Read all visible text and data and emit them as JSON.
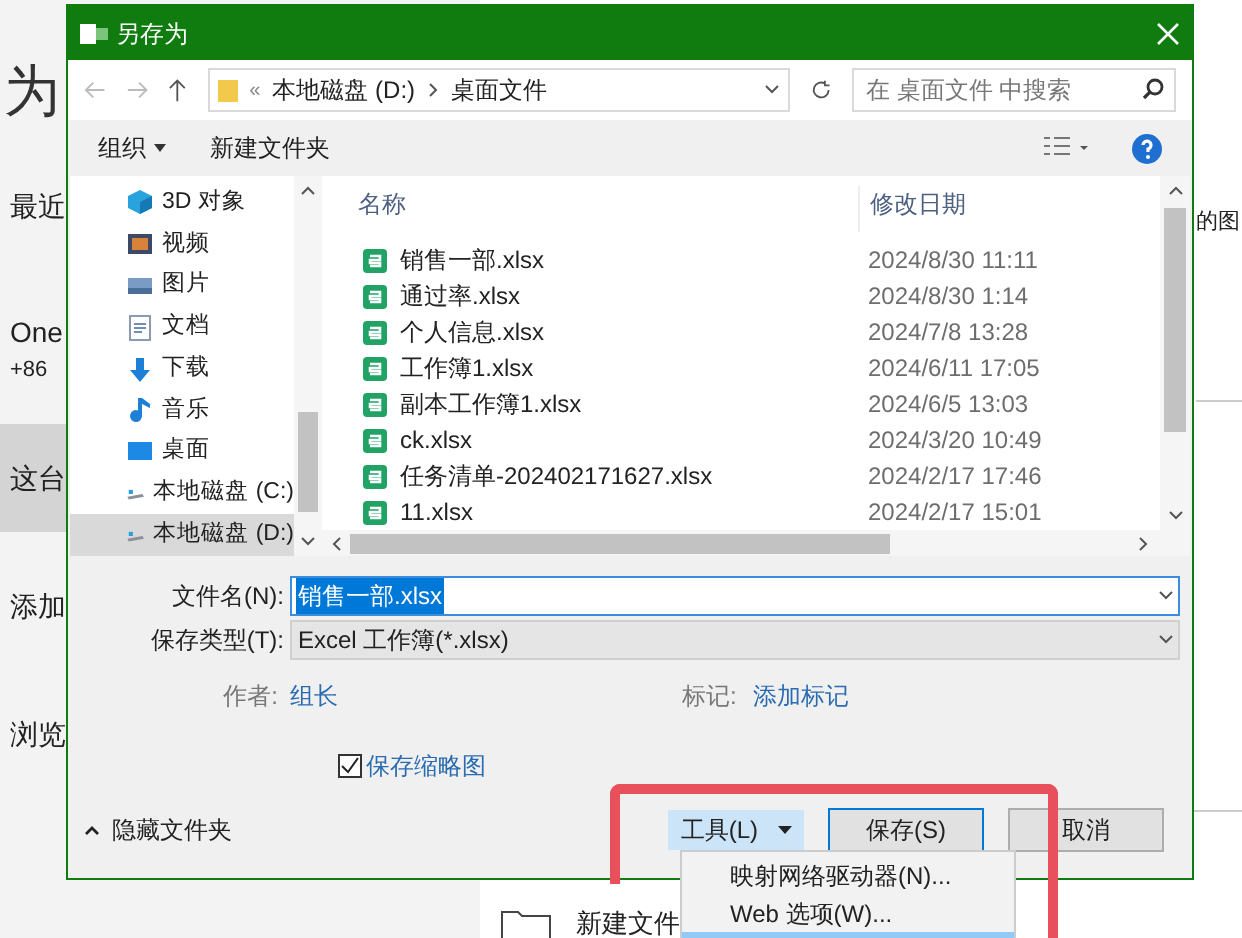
{
  "backstage": {
    "title": "为",
    "items": [
      {
        "label": "最近",
        "selected": false
      },
      {
        "label": "One",
        "sub": "+86",
        "selected": false
      },
      {
        "label": "这台",
        "selected": true
      },
      {
        "label": "添加",
        "selected": false
      },
      {
        "label": "浏览",
        "selected": false
      }
    ],
    "side_text": "的图",
    "new_folder": "新建文件"
  },
  "dialog": {
    "title": "另存为",
    "path_prefix": "«",
    "path": [
      "本地磁盘 (D:)",
      "桌面文件"
    ],
    "search": {
      "placeholder": "在 桌面文件 中搜索"
    },
    "organize": "组织",
    "new_folder": "新建文件夹",
    "nav": [
      {
        "label": "3D 对象",
        "kind": "cube",
        "selected": false
      },
      {
        "label": "视频",
        "kind": "video",
        "selected": false
      },
      {
        "label": "图片",
        "kind": "image",
        "selected": false
      },
      {
        "label": "文档",
        "kind": "doc",
        "selected": false
      },
      {
        "label": "下载",
        "kind": "download",
        "selected": false
      },
      {
        "label": "音乐",
        "kind": "music",
        "selected": false
      },
      {
        "label": "桌面",
        "kind": "desktop",
        "selected": false
      },
      {
        "label": "本地磁盘 (C:)",
        "kind": "drive",
        "selected": false
      },
      {
        "label": "本地磁盘 (D:)",
        "kind": "drive",
        "selected": true
      }
    ],
    "columns": [
      "名称",
      "修改日期"
    ],
    "files": [
      {
        "name": "销售一部.xlsx",
        "date": "2024/8/30 11:11"
      },
      {
        "name": "通过率.xlsx",
        "date": "2024/8/30 1:14"
      },
      {
        "name": "个人信息.xlsx",
        "date": "2024/7/8 13:28"
      },
      {
        "name": "工作簿1.xlsx",
        "date": "2024/6/11 17:05"
      },
      {
        "name": "副本工作簿1.xlsx",
        "date": "2024/6/5 13:03"
      },
      {
        "name": "ck.xlsx",
        "date": "2024/3/20 10:49"
      },
      {
        "name": "任务清单-202402171627.xlsx",
        "date": "2024/2/17 17:46"
      },
      {
        "name": "11.xlsx",
        "date": "2024/2/17 15:01"
      }
    ],
    "filename": {
      "label": "文件名(N):",
      "value": "销售一部.xlsx"
    },
    "filetype": {
      "label": "保存类型(T):",
      "value": "Excel 工作簿(*.xlsx)"
    },
    "author": {
      "label": "作者:",
      "value": "组长"
    },
    "tags": {
      "label": "标记:",
      "value": "添加标记"
    },
    "thumbnail": {
      "label": "保存缩略图",
      "checked": true
    },
    "hide_folders": "隐藏文件夹",
    "tools": "工具(L)",
    "save": "保存(S)",
    "cancel": "取消",
    "tools_menu": [
      {
        "label": "映射网络驱动器(N)...",
        "selected": false
      },
      {
        "label": "Web 选项(W)...",
        "selected": false
      },
      {
        "selected": true
      }
    ]
  }
}
